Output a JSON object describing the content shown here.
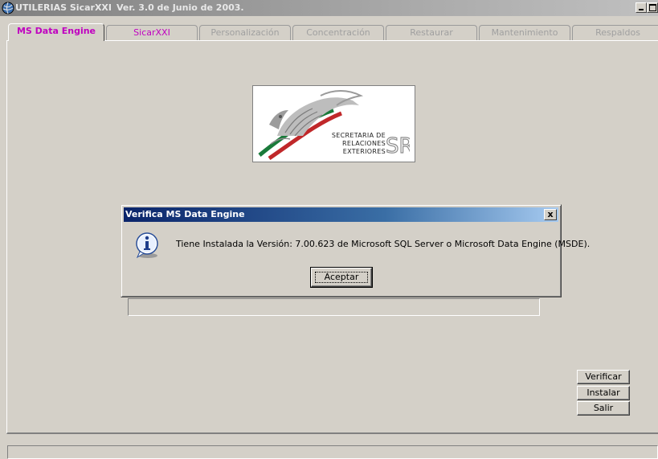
{
  "window": {
    "title": "UTILERIAS SicarXXI",
    "subtitle": "Ver. 3.0 de Junio de 2003."
  },
  "tabs": [
    {
      "label": "MS Data Engine",
      "active": true
    },
    {
      "label": "SicarXXI",
      "active": false
    },
    {
      "label": "Personalización",
      "active": false
    },
    {
      "label": "Concentración",
      "active": false
    },
    {
      "label": "Restaurar",
      "active": false
    },
    {
      "label": "Mantenimiento",
      "active": false
    },
    {
      "label": "Respaldos",
      "active": false
    }
  ],
  "logo": {
    "line1": "SECRETARIA DE",
    "line2": "RELACIONES",
    "line3": "EXTERIORES",
    "mark": "SRE",
    "colors": {
      "green": "#1a7a3a",
      "red": "#c0282a",
      "gray": "#8c8c8c"
    }
  },
  "dialog": {
    "title": "Verifica MS Data Engine",
    "close_symbol": "x",
    "message": "Tiene Instalada la Versión: 7.00.623 de Microsoft SQL Server o Microsoft Data Engine (MSDE).",
    "ok_label": "Aceptar",
    "icon": "info-icon"
  },
  "side_buttons": {
    "verificar": "Verificar",
    "instalar": "Instalar",
    "salir": "Salir"
  },
  "colors": {
    "face": "#d4d0c8",
    "active_tab_text": "#c000c0",
    "dialog_title_start": "#0a246a",
    "dialog_title_end": "#a6caf0"
  }
}
